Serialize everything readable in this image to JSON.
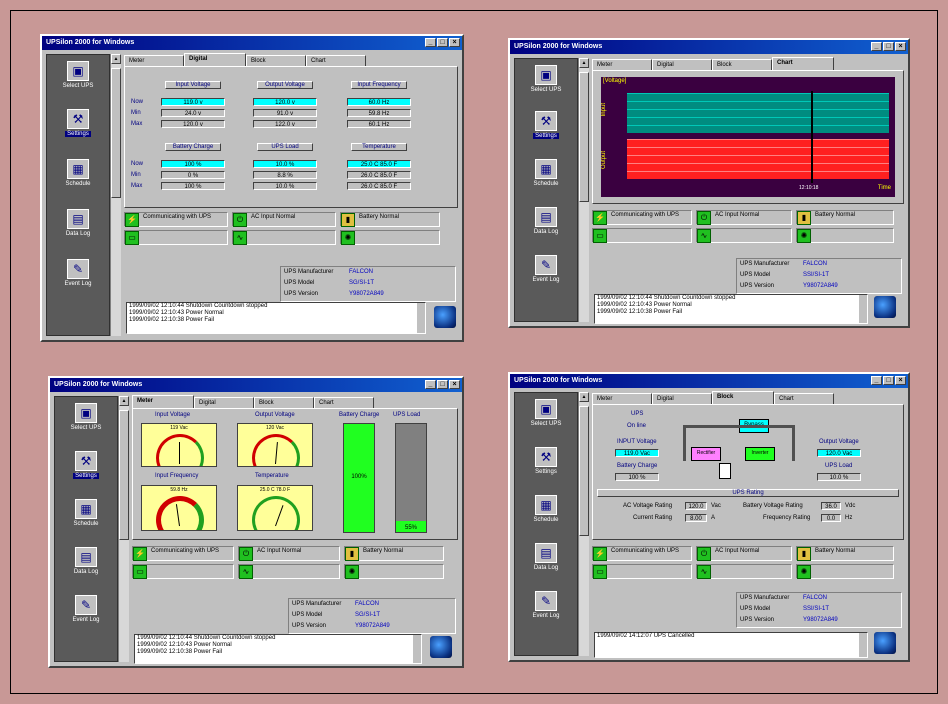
{
  "app_title": "UPSilon 2000 for Windows",
  "window_buttons": [
    "_",
    "□",
    "×"
  ],
  "sidebar": {
    "items": [
      {
        "label": "Select UPS",
        "icon": "computer-icon"
      },
      {
        "label": "Settings",
        "icon": "settings-icon"
      },
      {
        "label": "Schedule",
        "icon": "calendar-icon"
      },
      {
        "label": "Data Log",
        "icon": "datalog-icon"
      },
      {
        "label": "Event Log",
        "icon": "eventlog-icon"
      }
    ]
  },
  "tabs": [
    "Meter",
    "Digital",
    "Block",
    "Chart"
  ],
  "status": {
    "communicating": "Communicating with UPS",
    "ac_input": "AC Input Normal",
    "battery": "Battery Normal"
  },
  "ups_info": {
    "manufacturer_label": "UPS Manufacturer",
    "manufacturer": "FALCON",
    "model_label": "UPS Model",
    "model": "SG/SI-1T",
    "model_alt": "SSI/SI-1T",
    "version_label": "UPS Version",
    "version": "Y98072A849",
    "version_alt": "Y98072A849"
  },
  "log_tl": [
    "1999/09/02 12:10:44  Shutdown Countdown stopped",
    "1999/09/02 12:10:43  Power Normal",
    "1999/09/02 12:10:38  Power Fail"
  ],
  "log_tr": [
    "1999/09/02 12:10:44  Shutdown Countdown stopped",
    "1999/09/02 12:10:43  Power Normal",
    "1999/09/02 12:10:38  Power Fail"
  ],
  "log_bl": [
    "1999/09/02 12:10:44  Shutdown Countdown stopped",
    "1999/09/02 12:10:43  Power Normal",
    "1999/09/02 12:10:38  Power Fail"
  ],
  "log_br": [
    "1999/09/02 14:12:07  UPS Cancelled"
  ],
  "digital": {
    "row_labels": [
      "Now",
      "Min",
      "Max"
    ],
    "groups": [
      {
        "title": "Input Voltage",
        "values": [
          "119.0 v",
          "24.0 v",
          "120.0 v"
        ]
      },
      {
        "title": "Output Voltage",
        "values": [
          "120.0 v",
          "91.0 v",
          "122.0 v"
        ]
      },
      {
        "title": "Input Frequency",
        "values": [
          "60.0 Hz",
          "59.8 Hz",
          "60.1 Hz"
        ]
      },
      {
        "title": "Battery Charge",
        "values": [
          "100 %",
          "0 %",
          "100 %"
        ]
      },
      {
        "title": "UPS Load",
        "values": [
          "10.0 %",
          "8.8 %",
          "10.0 %"
        ]
      },
      {
        "title": "Temperature",
        "values": [
          "25.0 C  85.0 F",
          "26.0 C  85.0 F",
          "26.0 C  85.0 F"
        ]
      }
    ]
  },
  "chart": {
    "y_label": "[Voltage]",
    "section_top": "Input",
    "section_bottom": "Output",
    "x_label": "Time",
    "time_tick": "12:10:18",
    "colors": {
      "bg": "#3a0040",
      "input": "#008c80",
      "output": "#ff2020"
    }
  },
  "meter": {
    "titles": [
      "Input Voltage",
      "Output Voltage",
      "Battery Charge",
      "UPS Load",
      "Input Frequency",
      "Temperature"
    ],
    "dial_values": [
      "119 Vac",
      "120 Vac",
      "59.8 Hz",
      "25.0 C   78.0 F"
    ],
    "battery_charge": 1.0,
    "battery_label": "100%",
    "ups_load": 0.1,
    "load_label": "55%"
  },
  "block": {
    "ups_label": "UPS",
    "ups_status": "On line",
    "bypass": "Bypass",
    "input_voltage_label": "INPUT Voltage",
    "input_voltage": "119.0 Vac",
    "battery_charge_label": "Battery Charge",
    "battery_charge": "100 %",
    "output_voltage_label": "Output Voltage",
    "output_voltage": "120.0 Vac",
    "ups_load_label": "UPS Load",
    "ups_load": "10.0 %",
    "rating_title": "UPS Rating",
    "ac_voltage_rating_label": "AC Voltage Rating",
    "ac_voltage_rating": "120.0",
    "ac_voltage_unit": "Vac",
    "current_rating_label": "Current Rating",
    "current_rating": "8.00",
    "current_unit": "A",
    "battery_voltage_rating_label": "Battery Voltage Rating",
    "battery_voltage_rating": "36.0",
    "battery_voltage_unit": "Vdc",
    "frequency_rating_label": "Frequency Rating",
    "frequency_rating": "0.0",
    "frequency_unit": "Hz",
    "rectifier": "Rectifier",
    "inverter": "Inverter"
  }
}
